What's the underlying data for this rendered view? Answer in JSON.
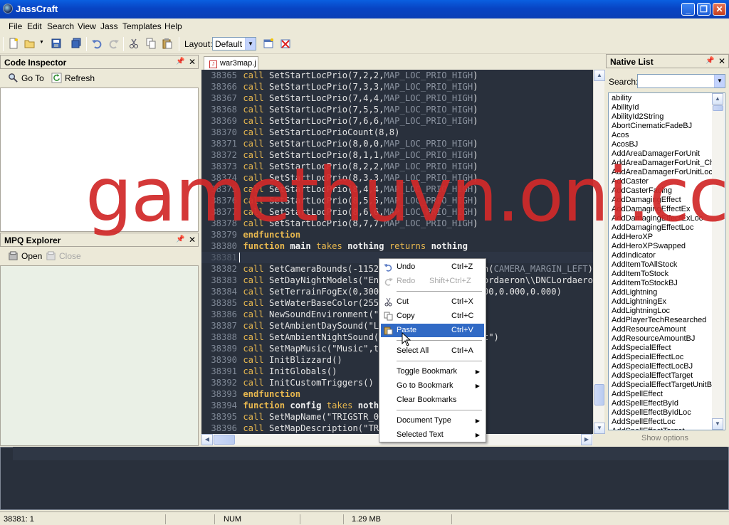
{
  "app": {
    "title": "JassCraft"
  },
  "menu": [
    "File",
    "Edit",
    "Search",
    "View",
    "Jass",
    "Templates",
    "Help"
  ],
  "toolbar": {
    "layout_label": "Layout:",
    "layout_value": "Default"
  },
  "code_inspector": {
    "title": "Code Inspector",
    "goto_label": "Go To",
    "refresh_label": "Refresh"
  },
  "mpq_explorer": {
    "title": "MPQ Explorer",
    "open_label": "Open",
    "close_label": "Close"
  },
  "editor": {
    "tab_label": "war3map.j",
    "lines": [
      {
        "no": "38365",
        "html": "<span class=\"kw\">call</span> <span class=\"fn\">SetStartLocPrio(7,2,2,</span><span class=\"cs\">MAP_LOC_PRIO_HIGH</span><span class=\"fn\">)</span>"
      },
      {
        "no": "38366",
        "html": "<span class=\"kw\">call</span> <span class=\"fn\">SetStartLocPrio(7,3,3,</span><span class=\"cs\">MAP_LOC_PRIO_HIGH</span><span class=\"fn\">)</span>"
      },
      {
        "no": "38367",
        "html": "<span class=\"kw\">call</span> <span class=\"fn\">SetStartLocPrio(7,4,4,</span><span class=\"cs\">MAP_LOC_PRIO_HIGH</span><span class=\"fn\">)</span>"
      },
      {
        "no": "38368",
        "html": "<span class=\"kw\">call</span> <span class=\"fn\">SetStartLocPrio(7,5,5,</span><span class=\"cs\">MAP_LOC_PRIO_HIGH</span><span class=\"fn\">)</span>"
      },
      {
        "no": "38369",
        "html": "<span class=\"kw\">call</span> <span class=\"fn\">SetStartLocPrio(7,6,6,</span><span class=\"cs\">MAP_LOC_PRIO_HIGH</span><span class=\"fn\">)</span>"
      },
      {
        "no": "38370",
        "html": "<span class=\"kw\">call</span> <span class=\"fn\">SetStartLocPrioCount(8,8)</span>"
      },
      {
        "no": "38371",
        "html": "<span class=\"kw\">call</span> <span class=\"fn\">SetStartLocPrio(8,0,0,</span><span class=\"cs\">MAP_LOC_PRIO_HIGH</span><span class=\"fn\">)</span>"
      },
      {
        "no": "38372",
        "html": "<span class=\"kw\">call</span> <span class=\"fn\">SetStartLocPrio(8,1,1,</span><span class=\"cs\">MAP_LOC_PRIO_HIGH</span><span class=\"fn\">)</span>"
      },
      {
        "no": "38373",
        "html": "<span class=\"kw\">call</span> <span class=\"fn\">SetStartLocPrio(8,2,2,</span><span class=\"cs\">MAP_LOC_PRIO_HIGH</span><span class=\"fn\">)</span>"
      },
      {
        "no": "38374",
        "html": "<span class=\"kw\">call</span> <span class=\"fn\">SetStartLocPrio(8,3,3,</span><span class=\"cs\">MAP_LOC_PRIO_HIGH</span><span class=\"fn\">)</span>"
      },
      {
        "no": "38375",
        "html": "<span class=\"kw\">call</span> <span class=\"fn\">SetStartLocPrio(8,4,4,</span><span class=\"cs\">MAP_LOC_PRIO_HIGH</span><span class=\"fn\">)</span>"
      },
      {
        "no": "38376",
        "html": "<span class=\"kw\">call</span> <span class=\"fn\">SetStartLocPrio(8,5,5,</span><span class=\"cs\">MAP_LOC_PRIO_HIGH</span><span class=\"fn\">)</span>"
      },
      {
        "no": "38377",
        "html": "<span class=\"kw\">call</span> <span class=\"fn\">SetStartLocPrio(8,6,6,</span><span class=\"cs\">MAP_LOC_PRIO_HIGH</span><span class=\"fn\">)</span>"
      },
      {
        "no": "38378",
        "html": "<span class=\"kw\">call</span> <span class=\"fn\">SetStartLocPrio(8,7,7,</span><span class=\"cs\">MAP_LOC_PRIO_HIGH</span><span class=\"fn\">)</span>"
      },
      {
        "no": "38379",
        "html": "<span class=\"kwb\" style=\"color:#e8b84f\">endfunction</span>"
      },
      {
        "no": "38380",
        "html": "<span class=\"kwb\" style=\"color:#e8b84f\">function</span> <span class=\"kwb\">main</span> <span class=\"kw\">takes</span> <span class=\"kwb\">nothing</span> <span class=\"kw\">returns</span> <span class=\"kwb\">nothing</span>"
      },
      {
        "no": "38381",
        "html": ""
      },
      {
        "no": "38382",
        "html": "<span class=\"kw\">call</span> <span class=\"fn\">SetCameraBounds(-11520.0 + GetCameraMargin(</span><span class=\"cs\">CAMERA_MARGIN_LEFT</span><span class=\"fn\">)</span>"
      },
      {
        "no": "38383",
        "html": "<span class=\"kw\">call</span> <span class=\"fn\">SetDayNightModels(\"Environment\\\\DNC\\\\DNCLordaeron\\\\DNCLordaeron</span>"
      },
      {
        "no": "38384",
        "html": "<span class=\"kw\">call</span> <span class=\"fn\">SetTerrainFogEx(0,3000.0,5000.0,0.500,0.000,0.000,0.000)</span>"
      },
      {
        "no": "38385",
        "html": "<span class=\"kw\">call</span> <span class=\"fn\">SetWaterBaseColor(255,255,255,255)</span>"
      },
      {
        "no": "38386",
        "html": "<span class=\"kw\">call</span> <span class=\"fn\">NewSoundEnvironment(\"Default\")</span>"
      },
      {
        "no": "38387",
        "html": "<span class=\"kw\">call</span> <span class=\"fn\">SetAmbientDaySound(\"LordaeronSummerDay\")</span>"
      },
      {
        "no": "38388",
        "html": "<span class=\"kw\">call</span> <span class=\"fn\">SetAmbientNightSound(\"LordaeronSummerNight\")</span>"
      },
      {
        "no": "38389",
        "html": "<span class=\"kw\">call</span> <span class=\"fn\">SetMapMusic(\"Music\",true,0)</span>"
      },
      {
        "no": "38390",
        "html": "<span class=\"kw\">call</span> <span class=\"fn\">InitBlizzard()</span>"
      },
      {
        "no": "38391",
        "html": "<span class=\"kw\">call</span> <span class=\"fn\">InitGlobals()</span>"
      },
      {
        "no": "38392",
        "html": "<span class=\"kw\">call</span> <span class=\"fn\">InitCustomTriggers()</span>"
      },
      {
        "no": "38393",
        "html": "<span class=\"kwb\" style=\"color:#e8b84f\">endfunction</span>"
      },
      {
        "no": "38394",
        "html": "<span class=\"kwb\" style=\"color:#e8b84f\">function</span> <span class=\"kwb\">config</span> <span class=\"kw\">takes</span> <span class=\"kwb\">nothing</span> <span class=\"kw\">returns</span> <span class=\"kwb\">nothing</span>"
      },
      {
        "no": "38395",
        "html": "<span class=\"kw\">call</span> <span class=\"fn\">SetMapName(\"TRIGSTR_001\")</span>"
      },
      {
        "no": "38396",
        "html": "<span class=\"kw\">call</span> <span class=\"fn\">SetMapDescription(\"TRIGSTR_003\")</span>"
      }
    ]
  },
  "native_list": {
    "title": "Native List",
    "search_label": "Search:",
    "items": [
      "ability",
      "AbilityId",
      "AbilityId2String",
      "AbortCinematicFadeBJ",
      "Acos",
      "AcosBJ",
      "AddAreaDamagerForUnit",
      "AddAreaDamagerForUnit_Chi",
      "AddAreaDamagerForUnitLoc",
      "AddCaster",
      "AddCasterFacing",
      "AddDamagingEffect",
      "AddDamagingEffectEx",
      "AddDamagingEffectExLoc",
      "AddDamagingEffectLoc",
      "AddHeroXP",
      "AddHeroXPSwapped",
      "AddIndicator",
      "AddItemToAllStock",
      "AddItemToStock",
      "AddItemToStockBJ",
      "AddLightning",
      "AddLightningEx",
      "AddLightningLoc",
      "AddPlayerTechResearched",
      "AddResourceAmount",
      "AddResourceAmountBJ",
      "AddSpecialEffect",
      "AddSpecialEffectLoc",
      "AddSpecialEffectLocBJ",
      "AddSpecialEffectTarget",
      "AddSpecialEffectTargetUnitBJ",
      "AddSpellEffect",
      "AddSpellEffectById",
      "AddSpellEffectByIdLoc",
      "AddSpellEffectLoc",
      "AddSpellEffectTarget"
    ],
    "show_options": "Show options"
  },
  "context_menu": {
    "undo": {
      "label": "Undo",
      "shortcut": "Ctrl+Z"
    },
    "redo": {
      "label": "Redo",
      "shortcut": "Shift+Ctrl+Z"
    },
    "cut": {
      "label": "Cut",
      "shortcut": "Ctrl+X"
    },
    "copy": {
      "label": "Copy",
      "shortcut": "Ctrl+C"
    },
    "paste": {
      "label": "Paste",
      "shortcut": "Ctrl+V"
    },
    "select_all": {
      "label": "Select All",
      "shortcut": "Ctrl+A"
    },
    "toggle_bookmark": "Toggle Bookmark",
    "goto_bookmark": "Go to Bookmark",
    "clear_bookmarks": "Clear Bookmarks",
    "document_type": "Document Type",
    "selected_text": "Selected Text"
  },
  "statusbar": {
    "position": "38381: 1",
    "num": "NUM",
    "memory": "1.29 MB"
  },
  "watermark": "gamethuvn.oni.cc",
  "colors": {
    "editor_bg": "#29303c",
    "keyword": "#e8b84f",
    "selection": "#316ac5",
    "titlebar": "#0844c4"
  }
}
